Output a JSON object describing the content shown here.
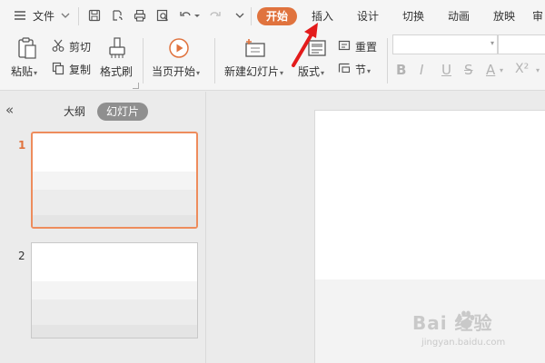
{
  "menubar": {
    "file_label": "文件",
    "tabs": [
      {
        "label": "开始",
        "active": true
      },
      {
        "label": "插入",
        "active": false
      },
      {
        "label": "设计",
        "active": false
      },
      {
        "label": "切换",
        "active": false
      },
      {
        "label": "动画",
        "active": false
      },
      {
        "label": "放映",
        "active": false
      },
      {
        "label": "审",
        "active": false
      }
    ]
  },
  "ribbon": {
    "paste_label": "粘贴",
    "cut_label": "剪切",
    "copy_label": "复制",
    "format_painter_label": "格式刷",
    "from_current_label": "当页开始",
    "new_slide_label": "新建幻灯片",
    "layout_label": "版式",
    "reset_label": "重置",
    "section_label": "节",
    "font_name_value": "",
    "font_size_value": "",
    "format_buttons": [
      "B",
      "I",
      "U",
      "S",
      "A",
      "X²"
    ]
  },
  "panel": {
    "tabs": [
      {
        "label": "大纲",
        "selected": false
      },
      {
        "label": "幻灯片",
        "selected": true
      }
    ],
    "slides": [
      {
        "number": "1",
        "selected": true
      },
      {
        "number": "2",
        "selected": false
      }
    ]
  },
  "watermark": {
    "brand": "Bai  经验",
    "url": "jingyan.baidu.com"
  },
  "colors": {
    "accent": "#e0733e",
    "selected_thumb_border": "#ee8c5c",
    "annotation_arrow": "#e31b1b",
    "panel_bg": "#ebebeb",
    "toolbar_bg": "#f5f5f5"
  },
  "icons": [
    "menu-icon",
    "chevron-down-icon",
    "save-icon",
    "export-pdf-icon",
    "print-icon",
    "print-preview-icon",
    "undo-icon",
    "redo-icon",
    "more-icon",
    "paste-icon",
    "cut-icon",
    "copy-icon",
    "format-painter-icon",
    "play-icon",
    "new-slide-icon",
    "layout-icon",
    "reset-icon",
    "section-icon",
    "collapse-icon",
    "paw-icon",
    "arrow-annotation-icon"
  ]
}
